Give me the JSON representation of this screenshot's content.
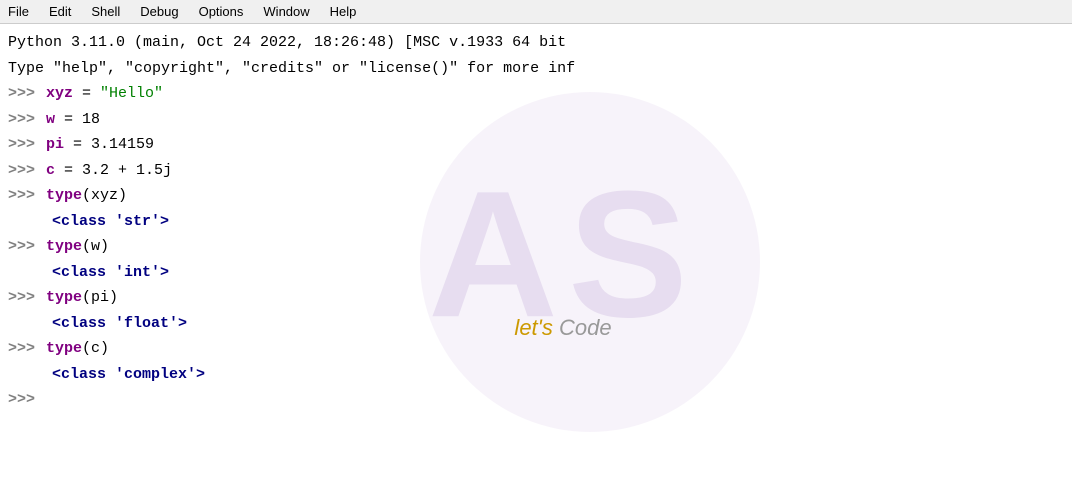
{
  "menu": {
    "items": [
      "File",
      "Edit",
      "Shell",
      "Debug",
      "Options",
      "Window",
      "Help"
    ]
  },
  "terminal": {
    "info_line1": "Python 3.11.0 (main, Oct 24 2022, 18:26:48) [MSC v.1933 64 bit",
    "info_line2": "Type \"help\", \"copyright\", \"credits\" or \"license()\" for more inf",
    "lines": [
      {
        "prompt": ">>> ",
        "code": "xyz = ",
        "str_val": "\"Hello\"",
        "type": "assignment"
      },
      {
        "prompt": ">>> ",
        "code": "w = 18",
        "type": "plain"
      },
      {
        "prompt": ">>> ",
        "code": "pi = 3.14159",
        "type": "plain"
      },
      {
        "prompt": ">>> ",
        "code": "c = 3.2 + 1.5j",
        "type": "plain"
      },
      {
        "prompt": ">>> ",
        "code_kw": "type",
        "code_rest": "(xyz)",
        "type": "func_call"
      },
      {
        "indent": true,
        "result": "<class 'str'>",
        "type": "result"
      },
      {
        "prompt": ">>> ",
        "code_kw": "type",
        "code_rest": "(w)",
        "type": "func_call"
      },
      {
        "indent": true,
        "result": "<class 'int'>",
        "type": "result"
      },
      {
        "prompt": ">>> ",
        "code_kw": "type",
        "code_rest": "(pi)",
        "type": "func_call"
      },
      {
        "indent": true,
        "result": "<class 'float'>",
        "type": "result"
      },
      {
        "prompt": ">>> ",
        "code_kw": "type",
        "code_rest": "(c)",
        "type": "func_call"
      },
      {
        "indent": true,
        "result": "<class 'complex'>",
        "type": "result"
      },
      {
        "prompt": ">>> ",
        "code": "",
        "type": "empty_prompt"
      }
    ],
    "watermark": {
      "letters": "AS",
      "tagline_let": "let's",
      "tagline_code": " Code"
    }
  }
}
